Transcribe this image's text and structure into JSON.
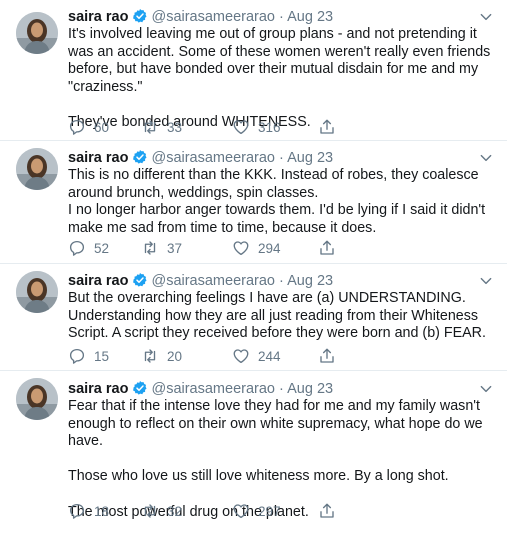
{
  "author": {
    "name": "saira rao",
    "handle": "@sairasameerarao",
    "separator": "·"
  },
  "icons": {
    "verified": "verified-badge-icon",
    "menu": "chevron-down-icon",
    "reply": "reply-icon",
    "retweet": "retweet-icon",
    "like": "like-icon",
    "share": "share-icon"
  },
  "colors": {
    "verified": "#1da1f2",
    "meta_text": "#657786",
    "divider": "#e6ecf0"
  },
  "tweets": [
    {
      "date": "Aug 23",
      "paragraphs": [
        "It's involved leaving me out of group plans - and not pretending it was an accident. Some of these women weren't really even friends before, but have bonded over their mutual disdain for me and my \"craziness.\"",
        "They've bonded around WHITENESS."
      ],
      "replies": "60",
      "retweets": "33",
      "likes": "316"
    },
    {
      "date": "Aug 23",
      "paragraphs": [
        "This is no different than the KKK. Instead of robes, they coalesce around brunch, weddings, spin classes.\nI no longer harbor anger towards them. I'd be lying if I said it didn't make me sad from time to time, because it does."
      ],
      "replies": "52",
      "retweets": "37",
      "likes": "294"
    },
    {
      "date": "Aug 23",
      "paragraphs": [
        "But the overarching feelings I have are (a) UNDERSTANDING. Understanding how they are all just reading from their Whiteness Script. A script they received before they were born and (b) FEAR."
      ],
      "replies": "15",
      "retweets": "20",
      "likes": "244"
    },
    {
      "date": "Aug 23",
      "paragraphs": [
        "Fear that if the intense love they had for me and my family wasn't enough to reflect on their own white supremacy, what hope do we have.",
        "Those who love us still love whiteness more. By a long shot.",
        "The most powerful drug on the planet."
      ],
      "replies": "18",
      "retweets": "32",
      "likes": "297"
    }
  ]
}
